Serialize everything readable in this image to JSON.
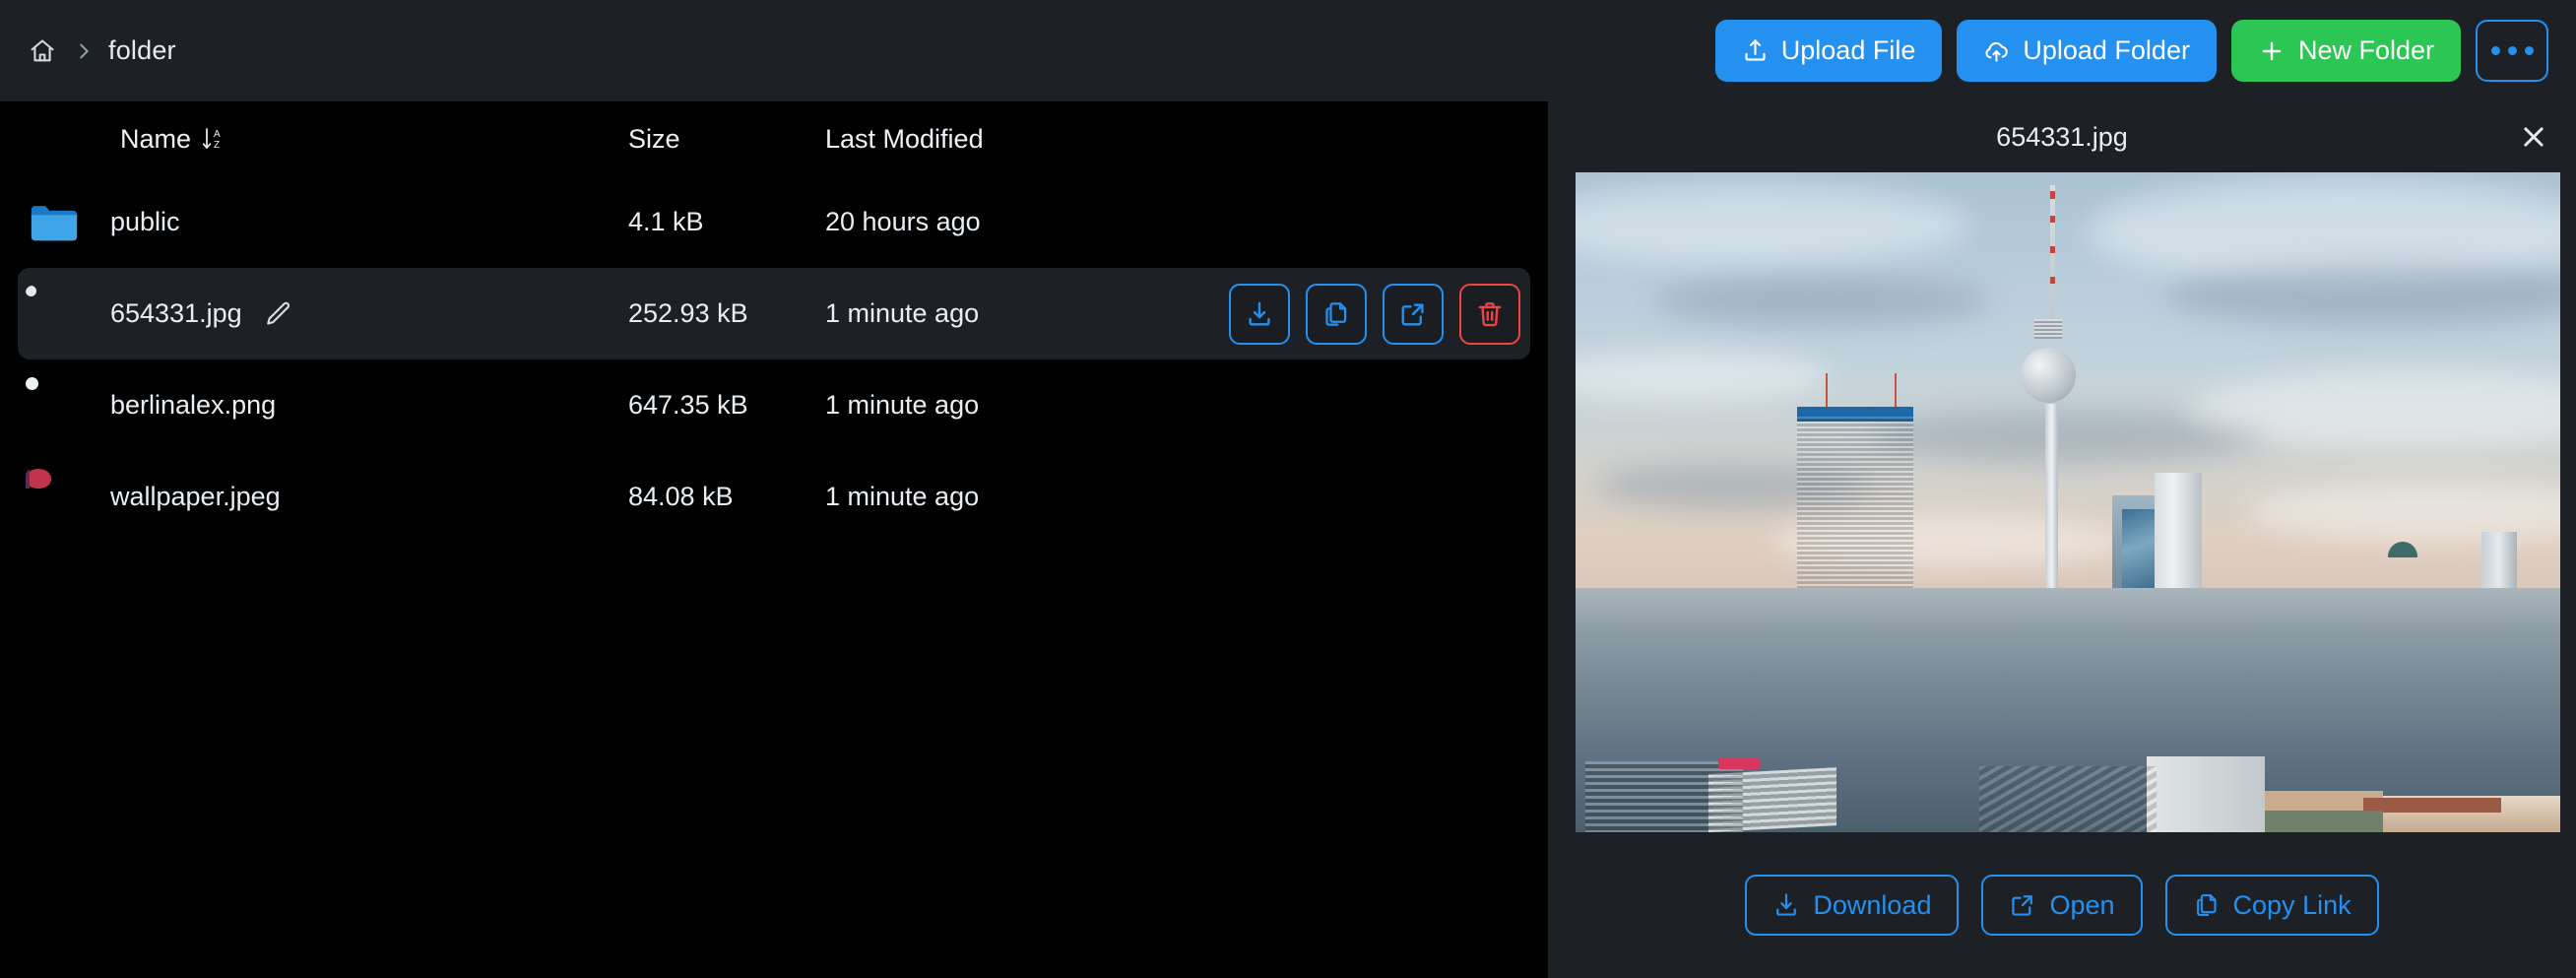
{
  "topbar": {
    "home_icon": "home-icon",
    "separator_icon": "chevron-right-icon",
    "breadcrumb_current": "folder",
    "buttons": [
      {
        "id": "upload-file",
        "label": "Upload File",
        "icon": "upload-icon",
        "style": "blue"
      },
      {
        "id": "upload-folder",
        "label": "Upload Folder",
        "icon": "cloud-upload-icon",
        "style": "blue"
      },
      {
        "id": "new-folder",
        "label": "New Folder",
        "icon": "plus-icon",
        "style": "green"
      }
    ],
    "more_button": {
      "id": "more-options",
      "icon": "ellipsis-icon"
    }
  },
  "filelist": {
    "columns": {
      "name": "Name",
      "size": "Size",
      "modified": "Last Modified"
    },
    "sort_icon": "sort-alpha-down-icon",
    "edit_icon": "pencil-icon",
    "rows": [
      {
        "name": "public",
        "size": "4.1 kB",
        "modified": "20 hours ago",
        "kind": "folder",
        "selected": false
      },
      {
        "name": "654331.jpg",
        "size": "252.93 kB",
        "modified": "1 minute ago",
        "kind": "image-city",
        "selected": true
      },
      {
        "name": "berlinalex.png",
        "size": "647.35 kB",
        "modified": "1 minute ago",
        "kind": "image-sky",
        "selected": false
      },
      {
        "name": "wallpaper.jpeg",
        "size": "84.08 kB",
        "modified": "1 minute ago",
        "kind": "image-wallpaper",
        "selected": false
      }
    ],
    "row_actions": [
      {
        "id": "download",
        "icon": "download-icon",
        "tone": "blue"
      },
      {
        "id": "copy",
        "icon": "copy-icon",
        "tone": "blue"
      },
      {
        "id": "open",
        "icon": "external-link-icon",
        "tone": "blue"
      },
      {
        "id": "delete",
        "icon": "trash-icon",
        "tone": "red"
      }
    ]
  },
  "preview": {
    "title": "654331.jpg",
    "close_icon": "close-icon",
    "image_alt": "Berlin Alexanderplatz skyline with Fernsehturm TV tower and Park Inn hotel at dusk",
    "buttons": [
      {
        "id": "download",
        "label": "Download",
        "icon": "download-icon"
      },
      {
        "id": "open",
        "label": "Open",
        "icon": "external-link-icon"
      },
      {
        "id": "copy-link",
        "label": "Copy Link",
        "icon": "copy-icon"
      }
    ]
  },
  "colors": {
    "accent_blue": "#2490f0",
    "accent_green": "#2bc653",
    "danger_red": "#ef4444",
    "panel_bg": "#1d2125",
    "list_bg": "#000000",
    "text_primary": "#e9eef3"
  }
}
